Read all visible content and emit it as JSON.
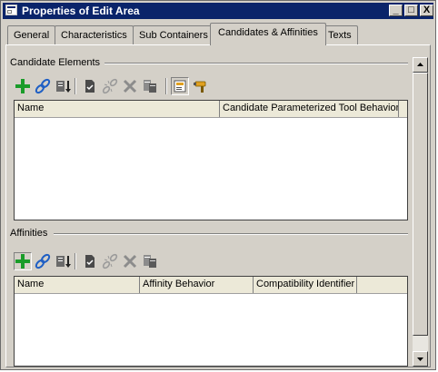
{
  "window": {
    "title": "Properties of Edit Area",
    "controls": {
      "minimize": "_",
      "maximize": "□",
      "close": "X"
    }
  },
  "tabs": [
    {
      "label": "General",
      "active": false
    },
    {
      "label": "Characteristics",
      "active": false
    },
    {
      "label": "Sub Containers",
      "active": false
    },
    {
      "label": "Candidates & Affinities",
      "active": true
    },
    {
      "label": "Texts",
      "active": false
    }
  ],
  "candidates": {
    "group_label": "Candidate Elements",
    "columns": [
      "Name",
      "Candidate Parameterized Tool Behavior"
    ],
    "rows": []
  },
  "affinities": {
    "group_label": "Affinities",
    "columns": [
      "Name",
      "Affinity Behavior",
      "Compatibility Identifier"
    ],
    "rows": []
  },
  "toolbar_icons": {
    "candidates": [
      "add-icon",
      "link-icon",
      "import-icon",
      "separator",
      "check-document-icon",
      "unlink-icon",
      "delete-icon",
      "database-icon",
      "separator",
      "properties-icon",
      "drill-icon"
    ],
    "affinities": [
      "add-icon",
      "link-icon",
      "import-icon",
      "separator",
      "check-document-icon",
      "unlink-icon",
      "delete-icon",
      "database-icon"
    ]
  },
  "colors": {
    "titlebar": "#0a246a",
    "face": "#d4d0c8",
    "add_green": "#1a9c2a",
    "link_blue": "#1f5fc4"
  }
}
